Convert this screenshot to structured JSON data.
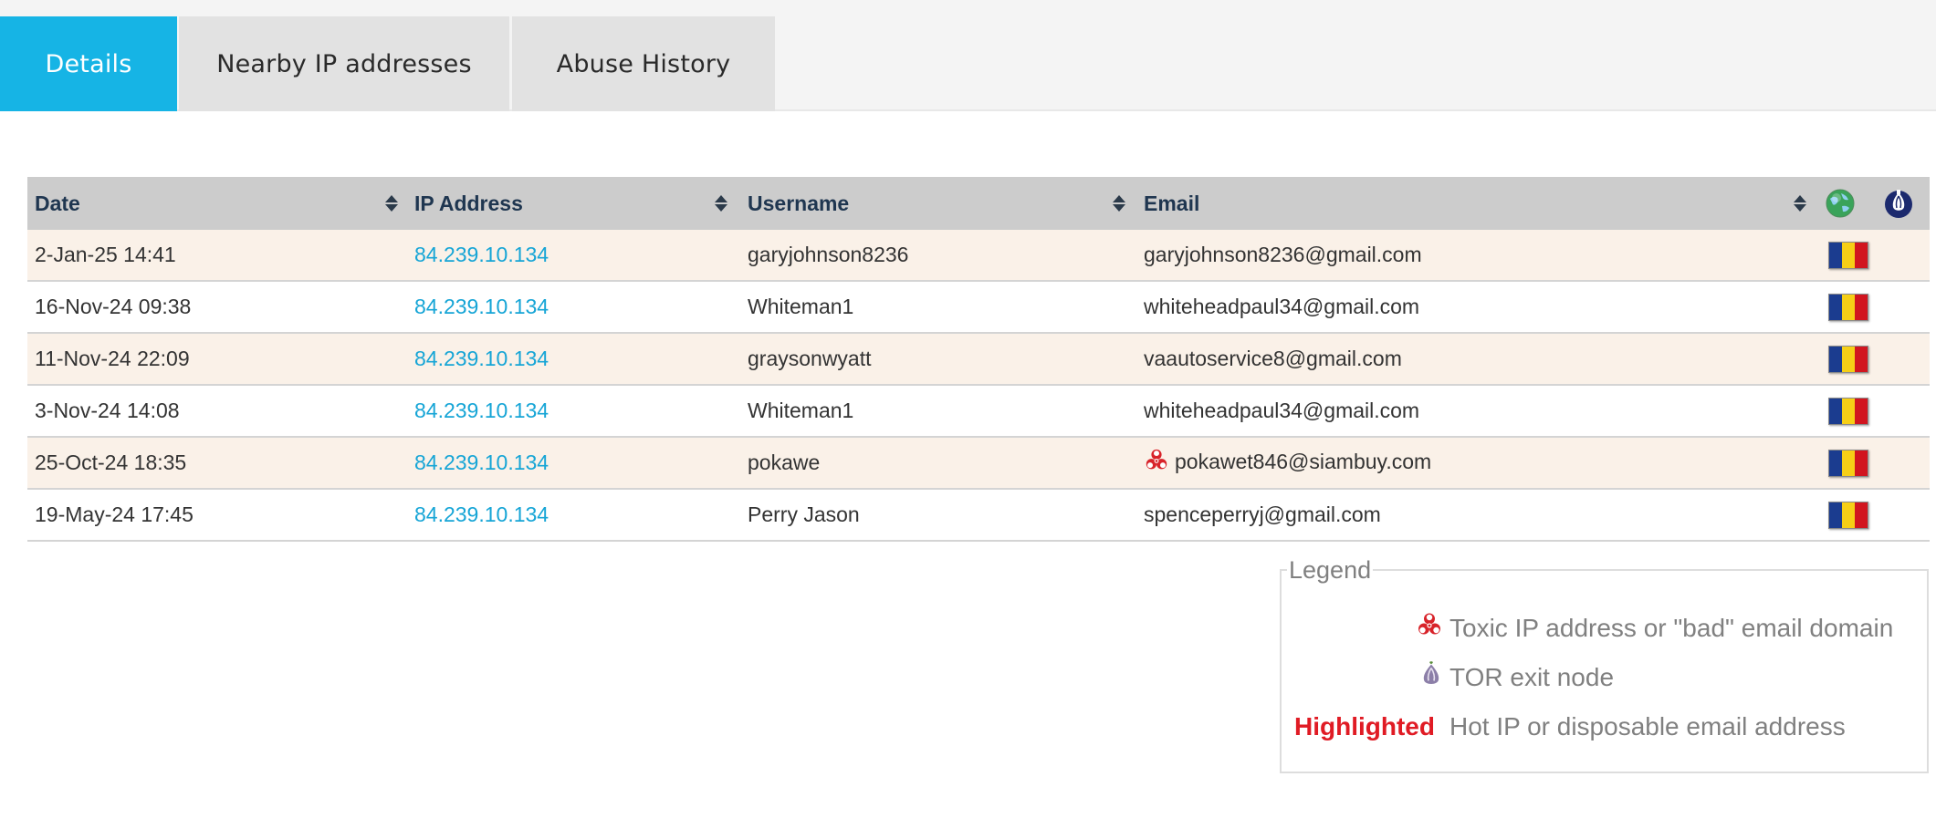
{
  "tabs": [
    {
      "label": "Details",
      "active": true
    },
    {
      "label": "Nearby IP addresses",
      "active": false
    },
    {
      "label": "Abuse History",
      "active": false
    }
  ],
  "table": {
    "columns": [
      "Date",
      "IP Address",
      "Username",
      "Email"
    ],
    "header_icons": [
      "globe-icon",
      "tor-onion-icon"
    ],
    "rows": [
      {
        "date": "2-Jan-25 14:41",
        "ip": "84.239.10.134",
        "username": "garyjohnson8236",
        "email": "garyjohnson8236@gmail.com",
        "toxic": false,
        "flag": "romania-flag-icon"
      },
      {
        "date": "16-Nov-24 09:38",
        "ip": "84.239.10.134",
        "username": "Whiteman1",
        "email": "whiteheadpaul34@gmail.com",
        "toxic": false,
        "flag": "romania-flag-icon"
      },
      {
        "date": "11-Nov-24 22:09",
        "ip": "84.239.10.134",
        "username": "graysonwyatt",
        "email": "vaautoservice8@gmail.com",
        "toxic": false,
        "flag": "romania-flag-icon"
      },
      {
        "date": "3-Nov-24 14:08",
        "ip": "84.239.10.134",
        "username": "Whiteman1",
        "email": "whiteheadpaul34@gmail.com",
        "toxic": false,
        "flag": "romania-flag-icon"
      },
      {
        "date": "25-Oct-24 18:35",
        "ip": "84.239.10.134",
        "username": "pokawe",
        "email": "pokawet846@siambuy.com",
        "toxic": true,
        "flag": "romania-flag-icon"
      },
      {
        "date": "19-May-24 17:45",
        "ip": "84.239.10.134",
        "username": "Perry Jason",
        "email": "spenceperryj@gmail.com",
        "toxic": false,
        "flag": "romania-flag-icon"
      }
    ]
  },
  "legend": {
    "title": "Legend",
    "items": [
      {
        "icon": "biohazard-icon",
        "text": "Toxic IP address or \"bad\" email domain"
      },
      {
        "icon": "tor-onion-icon",
        "text": "TOR exit node"
      },
      {
        "label": "Highlighted",
        "text": "Hot IP or disposable email address"
      }
    ]
  },
  "colors": {
    "tab_active": "#16b4e5",
    "link": "#16a5d6",
    "row_odd": "#faf1e8",
    "highlight": "#e01b24",
    "header_bg": "#cccccc"
  }
}
